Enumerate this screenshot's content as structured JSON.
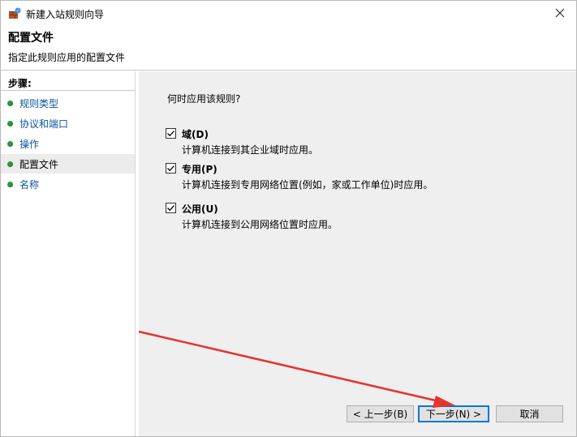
{
  "window": {
    "title": "新建入站规则向导",
    "close_label": "✕"
  },
  "header": {
    "title": "配置文件",
    "subtitle": "指定此规则应用的配置文件"
  },
  "steps": {
    "heading": "步骤:",
    "items": [
      {
        "label": "规则类型",
        "active": false
      },
      {
        "label": "协议和端口",
        "active": false
      },
      {
        "label": "操作",
        "active": false
      },
      {
        "label": "配置文件",
        "active": true
      },
      {
        "label": "名称",
        "active": false
      }
    ]
  },
  "content": {
    "question": "何时应用该规则?",
    "options": [
      {
        "label": "域(D)",
        "description": "计算机连接到其企业域时应用。",
        "checked": true
      },
      {
        "label": "专用(P)",
        "description": "计算机连接到专用网络位置(例如，家或工作单位)时应用。",
        "checked": true
      },
      {
        "label": "公用(U)",
        "description": "计算机连接到公用网络位置时应用。",
        "checked": true
      }
    ]
  },
  "buttons": {
    "back": "< 上一步(B)",
    "next": "下一步(N) >",
    "cancel": "取消"
  },
  "colors": {
    "accent": "#0078d7",
    "bullet": "#2e9a3a",
    "link": "#0b55a0",
    "annotation_arrow": "#e8322e"
  }
}
